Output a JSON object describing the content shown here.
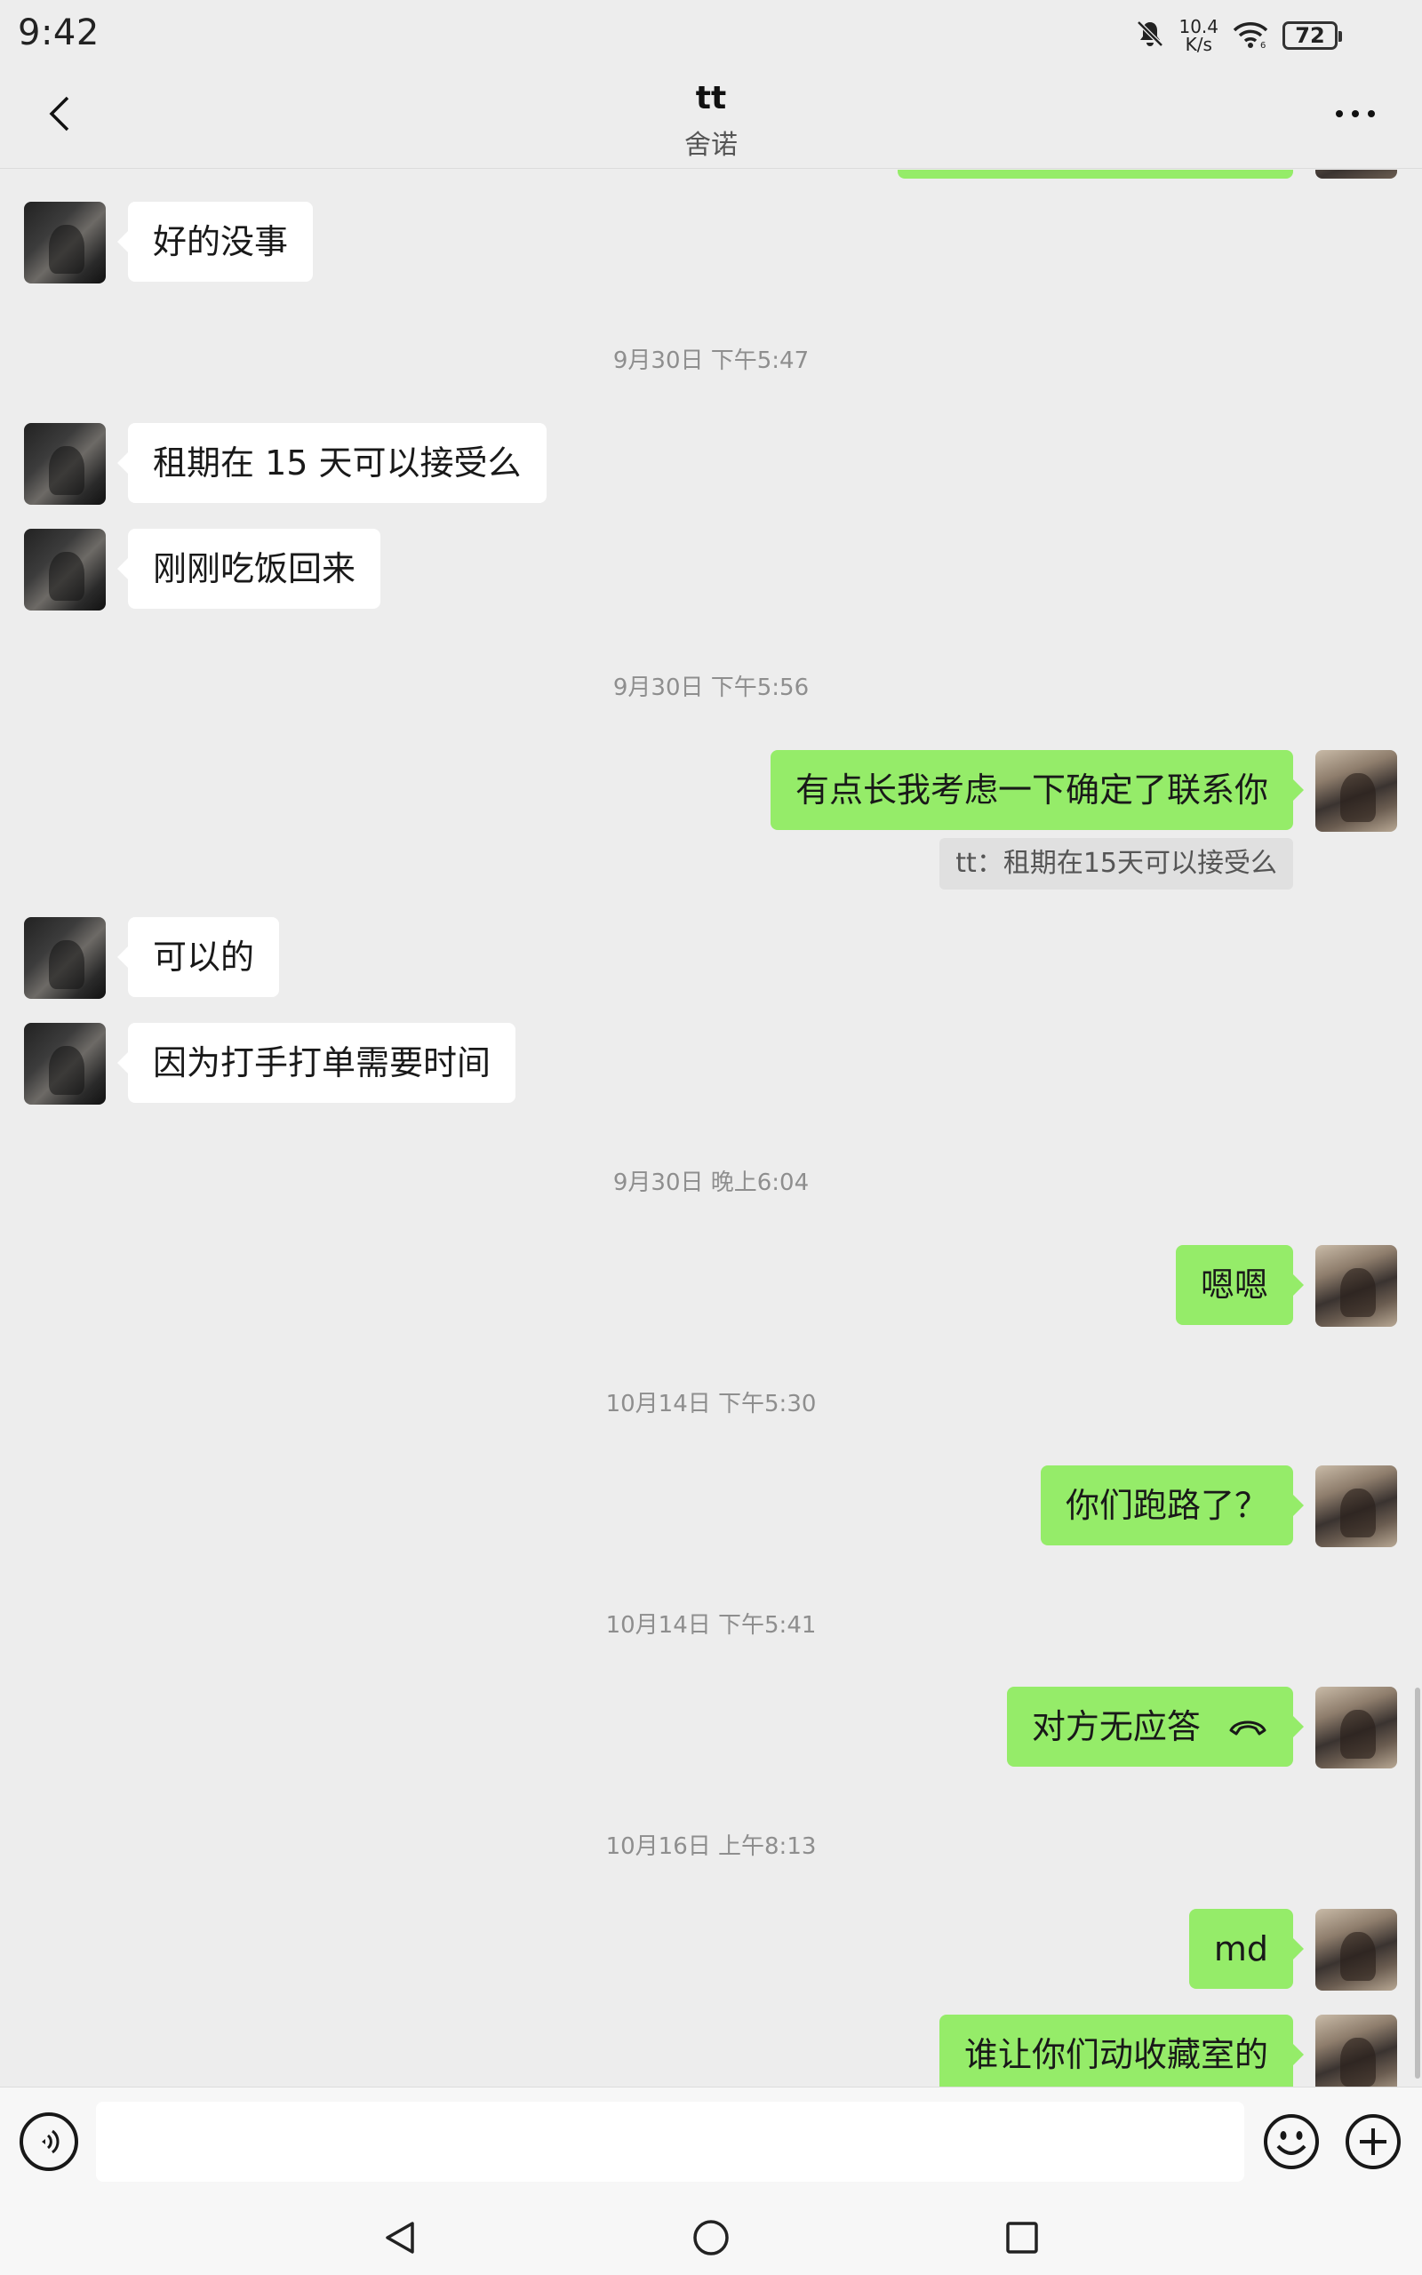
{
  "status_bar": {
    "time": "9:42",
    "net_speed_value": "10.4",
    "net_speed_unit": "K/s",
    "battery": "72",
    "icons": [
      "mute-bell-icon",
      "wifi-icon",
      "battery-icon"
    ]
  },
  "header": {
    "title": "tt",
    "subtitle": "舍诺",
    "back_icon": "chevron-left-icon",
    "more_icon": "more-dots-icon"
  },
  "messages": [
    {
      "type": "text",
      "from": "peer",
      "text": "好的没事"
    },
    {
      "type": "timestamp",
      "text": "9月30日 下午5:47"
    },
    {
      "type": "text",
      "from": "peer",
      "text": "租期在 15 天可以接受么"
    },
    {
      "type": "text",
      "from": "peer",
      "text": "刚刚吃饭回来"
    },
    {
      "type": "timestamp",
      "text": "9月30日 下午5:56"
    },
    {
      "type": "text",
      "from": "self",
      "text": "有点长我考虑一下确定了联系你",
      "quote": "tt：租期在15天可以接受么"
    },
    {
      "type": "text",
      "from": "peer",
      "text": "可以的"
    },
    {
      "type": "text",
      "from": "peer",
      "text": "因为打手打单需要时间"
    },
    {
      "type": "timestamp",
      "text": "9月30日 晚上6:04"
    },
    {
      "type": "text",
      "from": "self",
      "text": "嗯嗯"
    },
    {
      "type": "timestamp",
      "text": "10月14日 下午5:30"
    },
    {
      "type": "text",
      "from": "self",
      "text": "你们跑路了？"
    },
    {
      "type": "timestamp",
      "text": "10月14日 下午5:41"
    },
    {
      "type": "call",
      "from": "self",
      "text": "对方无应答",
      "icon": "hangup-phone-icon"
    },
    {
      "type": "timestamp",
      "text": "10月16日 上午8:13"
    },
    {
      "type": "text",
      "from": "self",
      "text": "md"
    },
    {
      "type": "text",
      "from": "self",
      "text": "谁让你们动收藏室的"
    }
  ],
  "input_bar": {
    "placeholder": "",
    "voice_icon": "voice-icon",
    "emoji_icon": "emoji-icon",
    "plus_icon": "plus-icon"
  },
  "nav_bar": {
    "icons": [
      "nav-back-icon",
      "nav-home-icon",
      "nav-recents-icon"
    ]
  },
  "colors": {
    "background": "#ededed",
    "self_bubble": "#95ec69",
    "peer_bubble": "#ffffff",
    "timestamp": "#8e8e8e"
  }
}
